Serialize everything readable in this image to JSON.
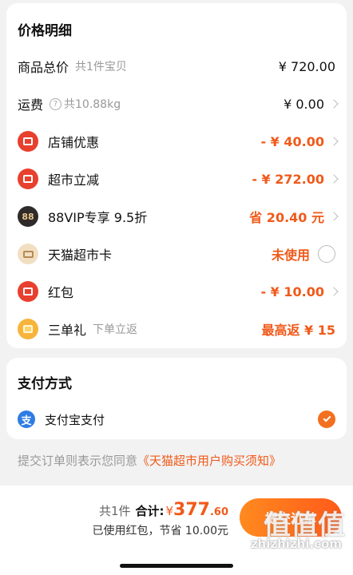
{
  "price_detail": {
    "title": "价格明细",
    "goods_total": {
      "label": "商品总价",
      "sub": "共1件宝贝",
      "value": "¥ 720.00"
    },
    "shipping": {
      "label": "运费",
      "help_icon": "?",
      "sub": "共10.88kg",
      "value": "¥ 0.00"
    },
    "store_discount": {
      "label": "店铺优惠",
      "value": "- ¥ 40.00",
      "icon": "coupon-icon"
    },
    "supermarket_cut": {
      "label": "超市立减",
      "value": "- ¥ 272.00",
      "icon": "discount-tag-icon"
    },
    "vip": {
      "label": "88VIP专享 9.5折",
      "icon_text": "88",
      "value": "省 20.40 元"
    },
    "tmall_card": {
      "label": "天猫超市卡",
      "value": "未使用",
      "icon": "card-icon"
    },
    "red_packet": {
      "label": "红包",
      "value": "- ¥ 10.00",
      "icon": "red-packet-icon"
    },
    "three_order": {
      "label": "三单礼",
      "sub": "下单立返",
      "value": "最高返 ¥ 15",
      "icon": "gift-card-icon"
    }
  },
  "payment": {
    "title": "支付方式",
    "method": {
      "label": "支付宝支付",
      "icon_text": "支",
      "selected": true
    }
  },
  "agreement": {
    "prefix": "提交订单则表示您同意",
    "link": "《天猫超市用户购买须知》"
  },
  "footer": {
    "count": "共1件",
    "total_label": "合计:",
    "currency": "¥",
    "total_int": "377",
    "total_dec": ".60",
    "saving": "已使用红包，节省 10.00元",
    "submit": "提交订单"
  },
  "watermark": {
    "logo": "值值值",
    "url": "zhizhizhi.com"
  },
  "colors": {
    "accent": "#f05a1a",
    "card_bg": "#ffffff",
    "page_bg": "#f2f2f2"
  }
}
